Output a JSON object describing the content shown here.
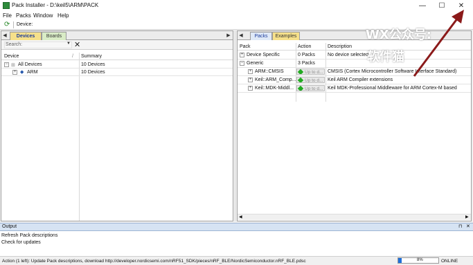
{
  "window": {
    "title": "Pack Installer - D:\\keil5\\ARM\\PACK",
    "controls": [
      "—",
      "☐",
      "✕"
    ]
  },
  "menu": [
    "File",
    "Packs",
    "Window",
    "Help"
  ],
  "toolbar": {
    "device_label": "Device:"
  },
  "left": {
    "tabs": [
      "Devices",
      "Boards"
    ],
    "search_label": "Search:",
    "columns": [
      "Device",
      "Summary"
    ],
    "rows": [
      {
        "name": "All Devices",
        "summary": "10 Devices"
      },
      {
        "name": "ARM",
        "summary": "10 Devices"
      }
    ]
  },
  "right": {
    "tabs": [
      "Packs",
      "Examples"
    ],
    "columns": [
      "Pack",
      "Action",
      "Description"
    ],
    "rows": [
      {
        "name": "Device Specific",
        "action": "0 Packs",
        "description": "No device selected"
      },
      {
        "name": "Generic",
        "action": "3 Packs",
        "description": ""
      },
      {
        "name": "ARM::CMSIS",
        "action": "Up to d...",
        "description": "CMSIS (Cortex Microcontroller Software Interface Standard)"
      },
      {
        "name": "Keil::ARM_Comp...",
        "action": "Up to d...",
        "description": "Keil ARM Compiler extensions"
      },
      {
        "name": "Keil::MDK-Middl...",
        "action": "Up to d...",
        "description": "Keil MDK-Professional Middleware for ARM Cortex-M based"
      }
    ]
  },
  "output": {
    "title": "Output",
    "lines": [
      "Refresh Pack descriptions",
      "Check for updates"
    ]
  },
  "status": {
    "message": "Action (1 left): Update Pack descriptions, download http://developer.nordicsemi.com/nRF51_SDK/pieces/nRF_BLE/NordicSemiconductor.nRF_BLE.pdsc",
    "progress_text": "8%",
    "progress": 8,
    "connection": "ONLINE"
  },
  "watermark": {
    "line1": "WX公众号:",
    "line2": "软件猫"
  },
  "colors": {
    "accent_arrow": "#8b1a1a",
    "progress": "#1e6fd9"
  }
}
